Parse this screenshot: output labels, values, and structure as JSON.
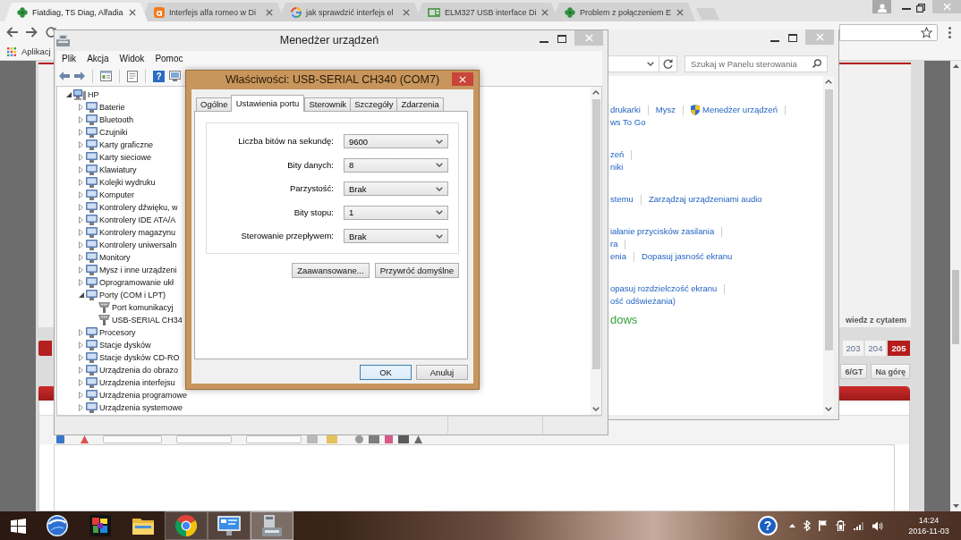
{
  "browser": {
    "tabs": [
      {
        "title": "Fiatdiag, TS Diag, Alfadia",
        "selected": true
      },
      {
        "title": "Interfejs alfa romeo w Di",
        "selected": false
      },
      {
        "title": "jak sprawdzić interfejs el",
        "selected": false
      },
      {
        "title": "ELM327 USB interface Di",
        "selected": false
      },
      {
        "title": "Problem z połączeniem E",
        "selected": false
      }
    ],
    "bookmarks": [
      {
        "label": "Aplikacj"
      }
    ],
    "page": {
      "quote_button": "wiedz z cytatem",
      "pages": [
        {
          "label": "203",
          "selected": false
        },
        {
          "label": "204",
          "selected": false
        },
        {
          "label": "205",
          "selected": true
        }
      ],
      "buttons": [
        "6/GT",
        "Na górę"
      ]
    }
  },
  "control_panel": {
    "search": {
      "placeholder": "Szukaj w Panelu sterowania"
    },
    "sections": [
      {
        "rows": [
          {
            "links": [
              {
                "text": "drukarki",
                "shield": false,
                "separator": true
              },
              {
                "text": "Mysz",
                "shield": false,
                "separator": true
              },
              {
                "text": "Menedżer urządzeń",
                "shield": true,
                "separator": true
              }
            ]
          },
          {
            "links": [
              {
                "text": "ws To Go",
                "shield": false,
                "separator": false
              }
            ]
          }
        ]
      },
      {
        "rows": [
          {
            "links": [
              {
                "text": "zeń",
                "shield": false,
                "separator": true
              }
            ]
          },
          {
            "links": [
              {
                "text": "niki",
                "shield": false,
                "separator": false
              }
            ]
          }
        ]
      },
      {
        "rows": [
          {
            "links": [
              {
                "text": "stemu",
                "shield": false,
                "separator": true
              },
              {
                "text": "Zarządzaj urządzeniami audio",
                "shield": false,
                "separator": false
              }
            ]
          }
        ]
      },
      {
        "rows": [
          {
            "links": [
              {
                "text": "iałanie przycisków zasilania",
                "shield": false,
                "separator": true
              }
            ]
          },
          {
            "links": [
              {
                "text": "ra",
                "shield": false,
                "separator": true
              }
            ]
          },
          {
            "links": [
              {
                "text": "enia",
                "shield": false,
                "separator": true
              },
              {
                "text": "Dopasuj jasność ekranu",
                "shield": false,
                "separator": false
              }
            ]
          }
        ]
      },
      {
        "rows": [
          {
            "links": [
              {
                "text": "opasuj rozdzielczość ekranu",
                "shield": false,
                "separator": true
              }
            ]
          },
          {
            "links": [
              {
                "text": "ość odświeżania)",
                "shield": false,
                "separator": false
              }
            ]
          }
        ]
      },
      {
        "heading": "dows"
      }
    ]
  },
  "device_manager": {
    "title": "Menedżer urządzeń",
    "menu": [
      "Plik",
      "Akcja",
      "Widok",
      "Pomoc"
    ],
    "toolbar": {
      "help": "?"
    },
    "tree": [
      {
        "label": "HP",
        "expanded": true,
        "children": [
          {
            "label": "Baterie",
            "expanded": false
          },
          {
            "label": "Bluetooth",
            "expanded": false
          },
          {
            "label": "Czujniki",
            "expanded": false
          },
          {
            "label": "Karty graficzne",
            "expanded": false
          },
          {
            "label": "Karty sieciowe",
            "expanded": false
          },
          {
            "label": "Klawiatury",
            "expanded": false
          },
          {
            "label": "Kolejki wydruku",
            "expanded": false
          },
          {
            "label": "Komputer",
            "expanded": false
          },
          {
            "label": "Kontrolery dźwięku, w",
            "expanded": false
          },
          {
            "label": "Kontrolery IDE ATA/A",
            "expanded": false
          },
          {
            "label": "Kontrolery magazynu",
            "expanded": false
          },
          {
            "label": "Kontrolery uniwersaln",
            "expanded": false
          },
          {
            "label": "Monitory",
            "expanded": false
          },
          {
            "label": "Mysz i inne urządzeni",
            "expanded": false
          },
          {
            "label": "Oprogramowanie ukł",
            "expanded": false
          },
          {
            "label": "Porty (COM i LPT)",
            "expanded": true,
            "children": [
              {
                "label": "Port komunikacyj"
              },
              {
                "label": "USB-SERIAL CH34"
              }
            ]
          },
          {
            "label": "Procesory",
            "expanded": false
          },
          {
            "label": "Stacje dysków",
            "expanded": false
          },
          {
            "label": "Stacje dysków CD-RO",
            "expanded": false
          },
          {
            "label": "Urządzenia do obrazo",
            "expanded": false
          },
          {
            "label": "Urządzenia interfejsu",
            "expanded": false
          },
          {
            "label": "Urządzenia programowe",
            "expanded": false
          },
          {
            "label": "Urządzenia systemowe",
            "expanded": false
          }
        ]
      }
    ]
  },
  "properties_dialog": {
    "title": "Właściwości: USB-SERIAL CH340 (COM7)",
    "tabs": [
      {
        "label": "Ogólne",
        "selected": false
      },
      {
        "label": "Ustawienia portu",
        "selected": true
      },
      {
        "label": "Sterownik",
        "selected": false
      },
      {
        "label": "Szczegóły",
        "selected": false
      },
      {
        "label": "Zdarzenia",
        "selected": false
      }
    ],
    "settings": [
      {
        "label": "Liczba bitów na sekundę:",
        "value": "9600"
      },
      {
        "label": "Bity danych:",
        "value": "8"
      },
      {
        "label": "Parzystość:",
        "value": "Brak"
      },
      {
        "label": "Bity stopu:",
        "value": "1"
      },
      {
        "label": "Sterowanie przepływem:",
        "value": "Brak"
      }
    ],
    "buttons": [
      "Zaawansowane...",
      "Przywróć domyślne"
    ],
    "footer_buttons": [
      {
        "label": "OK",
        "default": true
      },
      {
        "label": "Anuluj",
        "default": false
      }
    ]
  },
  "taskbar": {
    "apps": [
      {
        "running": false,
        "selected": false
      },
      {
        "running": false,
        "selected": false
      },
      {
        "running": false,
        "selected": false
      },
      {
        "running": true,
        "selected": false
      },
      {
        "running": true,
        "selected": false
      },
      {
        "running": true,
        "selected": true
      }
    ],
    "tray": {
      "help": "?"
    },
    "clock": {
      "time": "14:24",
      "date": "2016-11-03"
    }
  }
}
